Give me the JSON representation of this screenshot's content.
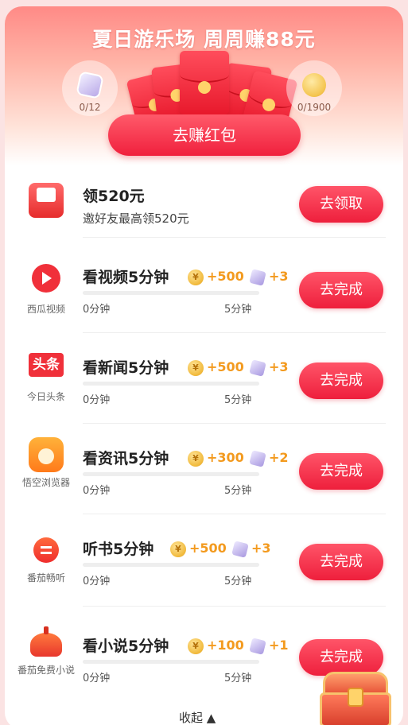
{
  "banner": {
    "title": "夏日游乐场 周周赚88元",
    "left_count": "0/12",
    "right_count": "0/1900",
    "cta_label": "去赚红包"
  },
  "invite": {
    "title": "领520元",
    "subtitle": "邀好友最高领520元",
    "button": "去领取"
  },
  "tasks": [
    {
      "app": "西瓜视频",
      "title": "看视频5分钟",
      "coins": "+500",
      "dice": "+3",
      "start": "0分钟",
      "end": "5分钟",
      "button": "去完成",
      "icon": "xigua-video-icon",
      "progress": 0
    },
    {
      "app": "今日头条",
      "title": "看新闻5分钟",
      "coins": "+500",
      "dice": "+3",
      "start": "0分钟",
      "end": "5分钟",
      "button": "去完成",
      "icon": "toutiao-icon",
      "progress": 0
    },
    {
      "app": "悟空浏览器",
      "title": "看资讯5分钟",
      "coins": "+300",
      "dice": "+2",
      "start": "0分钟",
      "end": "5分钟",
      "button": "去完成",
      "icon": "wukong-browser-icon",
      "progress": 0
    },
    {
      "app": "番茄畅听",
      "title": "听书5分钟",
      "coins": "+500",
      "dice": "+3",
      "start": "0分钟",
      "end": "5分钟",
      "button": "去完成",
      "icon": "fanqie-listen-icon",
      "progress": 0
    },
    {
      "app": "番茄免费小说",
      "title": "看小说5分钟",
      "coins": "+100",
      "dice": "+1",
      "start": "0分钟",
      "end": "5分钟",
      "button": "去完成",
      "icon": "fanqie-novel-icon",
      "progress": 0
    }
  ],
  "footer": {
    "collapse_label": "收起 ▲"
  },
  "colors": {
    "accent": "#f0203d",
    "reward": "#f39a1e",
    "card_bg": "#ffffff"
  }
}
